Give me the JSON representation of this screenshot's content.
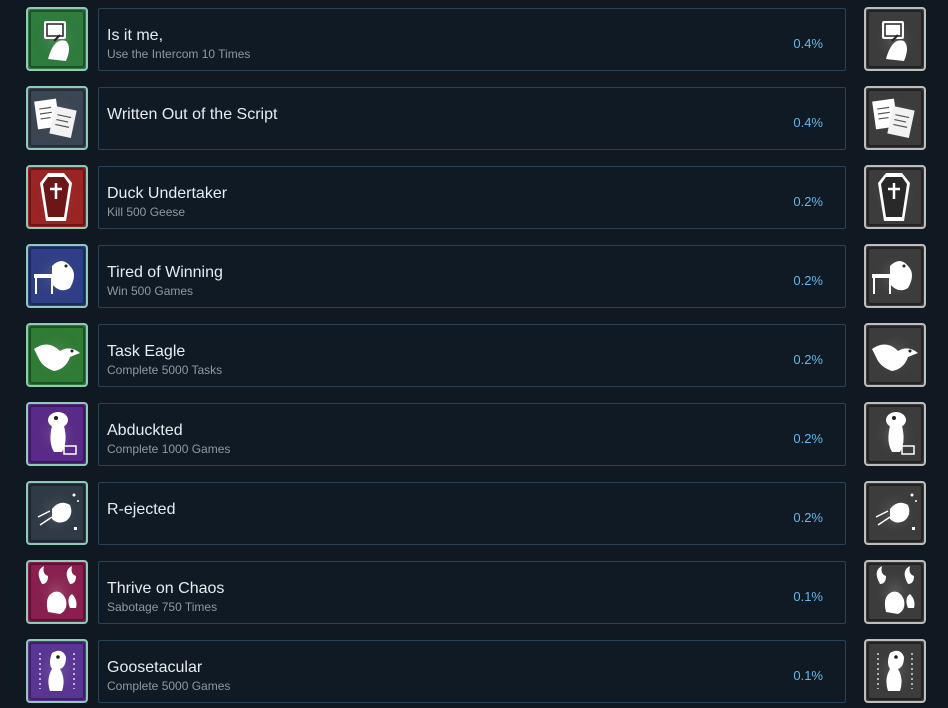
{
  "achievements": [
    {
      "title": "Is it me,",
      "description": "Use the Intercom 10 Times",
      "percent": "0.4%",
      "icon": "intercom-icon",
      "color": "#2e7d3e"
    },
    {
      "title": "Written Out of the Script",
      "description": "",
      "percent": "0.4%",
      "icon": "script-pages-icon",
      "color": "#3b4654"
    },
    {
      "title": "Duck Undertaker",
      "description": "Kill 500 Geese",
      "percent": "0.2%",
      "icon": "coffin-icon",
      "color": "#9b2424"
    },
    {
      "title": "Tired of Winning",
      "description": "Win 500 Games",
      "percent": "0.2%",
      "icon": "tired-duck-icon",
      "color": "#2f3f86"
    },
    {
      "title": "Task Eagle",
      "description": "Complete 5000 Tasks",
      "percent": "0.2%",
      "icon": "eagle-icon",
      "color": "#2f7d34"
    },
    {
      "title": "Abduckted",
      "description": "Complete 1000 Games",
      "percent": "0.2%",
      "icon": "abducted-duck-icon",
      "color": "#5a2a8a"
    },
    {
      "title": "R-ejected",
      "description": "",
      "percent": "0.2%",
      "icon": "ejected-goose-icon",
      "color": "#2f3a47"
    },
    {
      "title": "Thrive on Chaos",
      "description": "Sabotage 750 Times",
      "percent": "0.1%",
      "icon": "chaos-flames-icon",
      "color": "#8a1f4f"
    },
    {
      "title": "Goosetacular",
      "description": "Complete 5000 Games",
      "percent": "0.1%",
      "icon": "goose-spotlight-icon",
      "color": "#5b3596"
    }
  ]
}
